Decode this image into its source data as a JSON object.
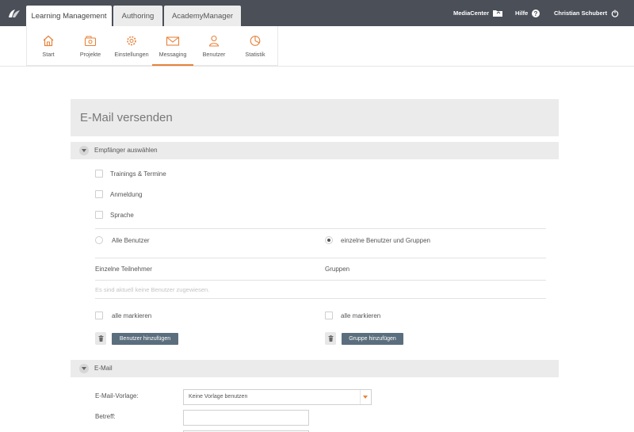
{
  "header": {
    "tabs": [
      {
        "label": "Learning Management",
        "active": true
      },
      {
        "label": "Authoring",
        "active": false
      },
      {
        "label": "AcademyManager",
        "active": false
      }
    ],
    "mediacenter_label": "MediaCenter",
    "help_label": "Hilfe",
    "user_name": "Christian Schubert"
  },
  "modules": [
    {
      "label": "Start",
      "icon": "home-icon"
    },
    {
      "label": "Projekte",
      "icon": "projects-icon"
    },
    {
      "label": "Einstellungen",
      "icon": "settings-icon"
    },
    {
      "label": "Messaging",
      "icon": "envelope-icon",
      "active": true
    },
    {
      "label": "Benutzer",
      "icon": "user-icon"
    },
    {
      "label": "Statistik",
      "icon": "statistics-icon"
    }
  ],
  "page": {
    "title": "E-Mail versenden"
  },
  "recipients": {
    "section_label": "Empfänger auswählen",
    "filters": [
      "Trainings & Termine",
      "Anmeldung",
      "Sprache"
    ],
    "radio_all": "Alle Benutzer",
    "radio_individual": "einzelne Benutzer und Gruppen",
    "col_participants": "Einzelne Teilnehmer",
    "col_groups": "Gruppen",
    "empty_hint": "Es sind aktuell keine Benutzer zugewiesen.",
    "select_all_left": "alle markieren",
    "select_all_right": "alle markieren",
    "add_users_button": "Benutzer hinzufügen",
    "add_group_button": "Gruppe hinzufügen"
  },
  "email": {
    "section_label": "E-Mail",
    "template_label": "E-Mail-Vorlage:",
    "template_value": "Keine Vorlage benutzen",
    "subject_label": "Betreff:",
    "subject_value": ""
  },
  "colors": {
    "topbar": "#4a4f58",
    "accent": "#e8823a",
    "button": "#5b6e7e"
  }
}
